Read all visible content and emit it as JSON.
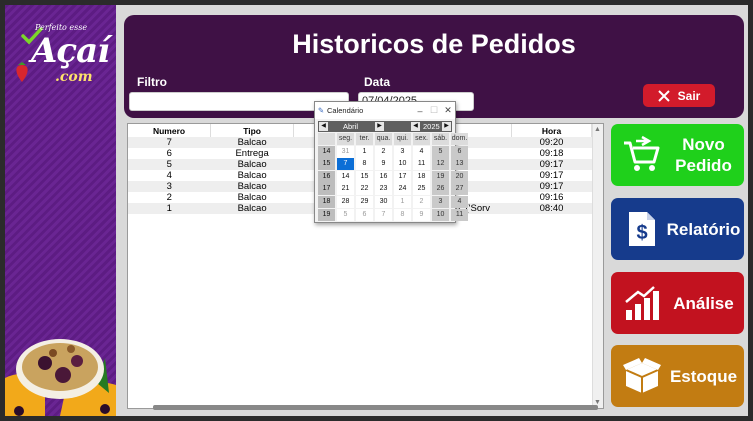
{
  "sidebar": {
    "logo_tagline": "Perfeito esse",
    "logo_word": "Açaí",
    "logo_suffix": ".com"
  },
  "header": {
    "title": "Historicos de Pedidos",
    "filtro_label": "Filtro",
    "filtro_value": "",
    "data_label": "Data",
    "data_value": "07/04/2025",
    "sair_label": "Sair"
  },
  "table": {
    "columns": [
      "Numero",
      "Tipo",
      "",
      "",
      "Hora"
    ],
    "rows": [
      {
        "numero": "7",
        "tipo": "Balcao",
        "detalhe": "",
        "hora": "09:20"
      },
      {
        "numero": "6",
        "tipo": "Entrega",
        "detalhe": "",
        "hora": "09:18"
      },
      {
        "numero": "5",
        "tipo": "Balcao",
        "detalhe": "",
        "hora": "09:17"
      },
      {
        "numero": "4",
        "tipo": "Balcao",
        "detalhe": ")]),)",
        "hora": "09:17"
      },
      {
        "numero": "3",
        "tipo": "Balcao",
        "detalhe": "[(1, 22.0)])",
        "hora": "09:17"
      },
      {
        "numero": "2",
        "tipo": "Balcao",
        "detalhe": "",
        "hora": "09:16"
      },
      {
        "numero": "1",
        "tipo": "Balcao",
        "detalhe": "(('Ac",
        "detalhe2": "23, 23.0)]), ('Sorv",
        "hora": "08:40"
      }
    ]
  },
  "buttons": {
    "novo_pedido": [
      "Novo",
      "Pedido"
    ],
    "relatorio": "Relatório",
    "analise": "Análise",
    "estoque": "Estoque"
  },
  "colors": {
    "novo_pedido": "#1fd01b",
    "relatorio": "#163b8c",
    "analise": "#c2121f",
    "estoque": "#c27c12",
    "header": "#3f1145",
    "sidebar": "#5d1c83"
  },
  "calendar": {
    "window_title": "Calendário",
    "month": "Abril",
    "year": "2025",
    "weekday_headers": [
      "seg.",
      "ter.",
      "qua.",
      "qui.",
      "sex.",
      "sáb.",
      "dom."
    ],
    "weeks": [
      {
        "wk": "14",
        "days": [
          "31",
          "1",
          "2",
          "3",
          "4",
          "5",
          "6"
        ]
      },
      {
        "wk": "15",
        "days": [
          "7",
          "8",
          "9",
          "10",
          "11",
          "12",
          "13"
        ]
      },
      {
        "wk": "16",
        "days": [
          "14",
          "15",
          "16",
          "17",
          "18",
          "19",
          "20"
        ]
      },
      {
        "wk": "17",
        "days": [
          "21",
          "22",
          "23",
          "24",
          "25",
          "26",
          "27"
        ]
      },
      {
        "wk": "18",
        "days": [
          "28",
          "29",
          "30",
          "1",
          "2",
          "3",
          "4"
        ]
      },
      {
        "wk": "19",
        "days": [
          "5",
          "6",
          "7",
          "8",
          "9",
          "10",
          "11"
        ]
      }
    ],
    "selected_day": "7"
  }
}
